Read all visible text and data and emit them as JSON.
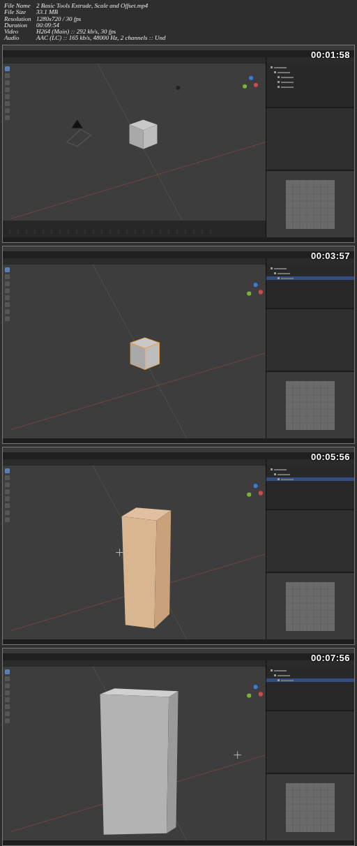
{
  "info": [
    {
      "label": "File Name",
      "value": "2 Basic Tools Extrude, Scale and Offset.mp4"
    },
    {
      "label": "File Size",
      "value": "33.1 MB"
    },
    {
      "label": "Resolution",
      "value": "1280x720 / 30 fps"
    },
    {
      "label": "Duration",
      "value": "00:09:54"
    },
    {
      "label": "Video",
      "value": "H264 (Main) :: 292 kb/s, 30 fps"
    },
    {
      "label": "Audio",
      "value": "AAC (LC) :: 165 kb/s, 48000 Hz, 2 channels :: Und"
    }
  ],
  "frames": [
    {
      "timestamp": "00:01:58",
      "kind": "cube",
      "timeline": true,
      "outliner": [
        {
          "selected": false
        },
        {
          "selected": false
        },
        {
          "selected": false
        },
        {
          "selected": false
        },
        {
          "selected": false
        }
      ]
    },
    {
      "timestamp": "00:03:57",
      "kind": "selected-cube",
      "outliner": [
        {
          "selected": false
        },
        {
          "selected": false
        },
        {
          "selected": true
        }
      ]
    },
    {
      "timestamp": "00:05:56",
      "kind": "tall-box",
      "outliner": [
        {
          "selected": false
        },
        {
          "selected": false
        },
        {
          "selected": true
        }
      ]
    },
    {
      "timestamp": "00:07:56",
      "kind": "slab",
      "outliner": [
        {
          "selected": false
        },
        {
          "selected": false
        },
        {
          "selected": true
        }
      ]
    }
  ]
}
